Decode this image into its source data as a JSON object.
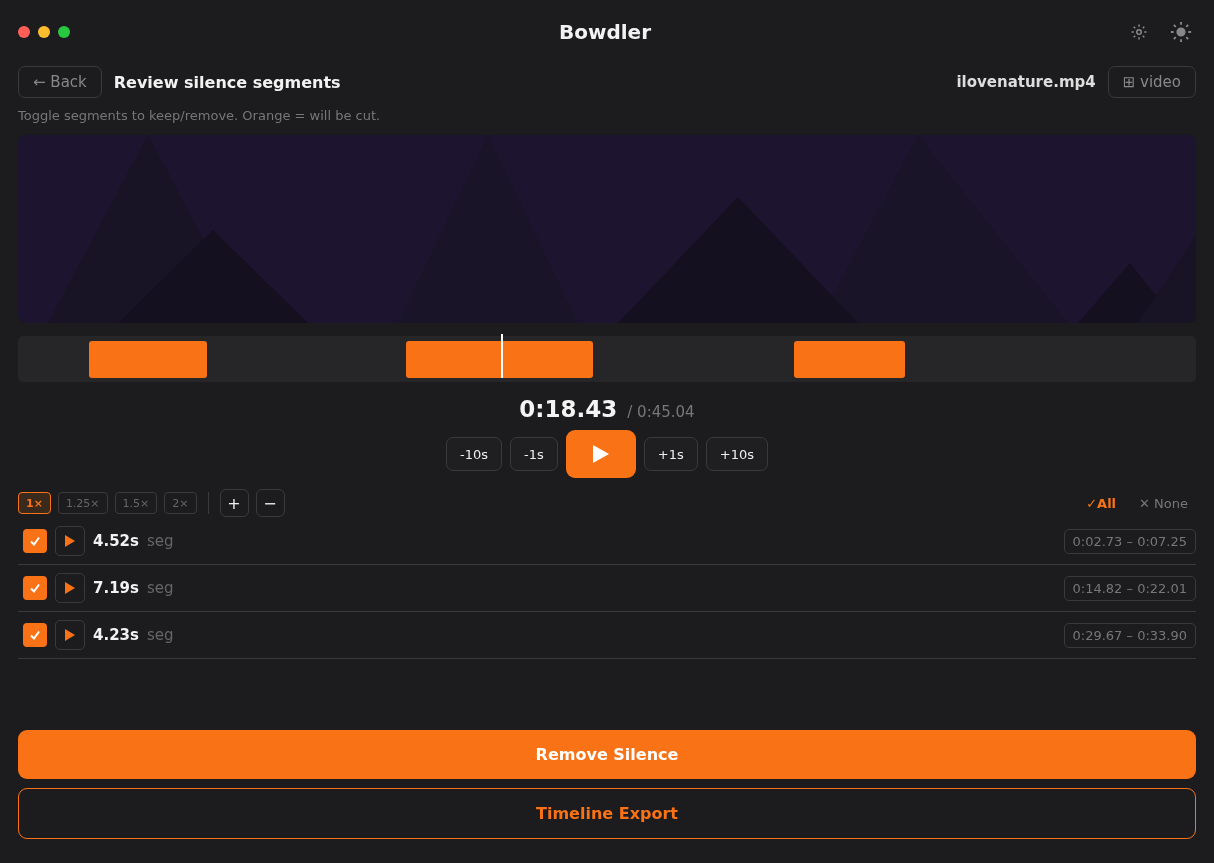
{
  "window": {
    "title": "Bowdler"
  },
  "header": {
    "back": "← Back",
    "title": "Review silence segments",
    "file": "ilovenature.mp4",
    "view_toggle": "⊞ video",
    "subtitle": "Toggle segments to keep/remove. Orange = will be cut."
  },
  "preview": {
    "kind": "picture"
  },
  "timeline": {
    "level": 0.41
  },
  "time": {
    "current": "0:18.43",
    "total": "/ 0:45.04"
  },
  "transport": [
    "-10s",
    "-1s",
    "+1s",
    "+10s"
  ],
  "speeds": [
    {
      "label": "1×",
      "selected": true
    },
    {
      "label": "1.25×",
      "selected": false
    },
    {
      "label": "1.5×",
      "selected": false
    },
    {
      "label": "2×",
      "selected": false
    }
  ],
  "zoom": [
    "+",
    "−"
  ],
  "select": [
    {
      "label": "✓All",
      "selected": true
    },
    {
      "label": "✕ None",
      "selected": false
    }
  ],
  "segments": [
    {
      "checked": true,
      "duration": "4.52s",
      "tag": "seg",
      "range": "0:02.73 – 0:07.25"
    },
    {
      "checked": true,
      "duration": "7.19s",
      "tag": "seg",
      "range": "0:14.82 – 0:22.01"
    },
    {
      "checked": true,
      "duration": "4.23s",
      "tag": "seg",
      "range": "0:29.67 – 0:33.90"
    }
  ],
  "actions": {
    "primary": "Remove Silence",
    "secondary": "Timeline Export"
  }
}
